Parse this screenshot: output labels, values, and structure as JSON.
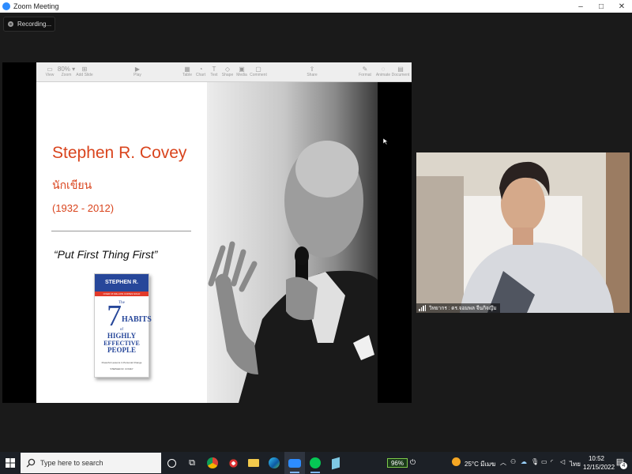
{
  "window": {
    "title": "Zoom Meeting",
    "controls": [
      "–",
      "□",
      "✕"
    ]
  },
  "recording": {
    "label": "Recording..."
  },
  "keynote_toolbar": {
    "items": [
      {
        "label": "View",
        "glyph": "▭"
      },
      {
        "label": "Zoom",
        "glyph": "80% ▾"
      },
      {
        "label": "Add Slide",
        "glyph": "⊞"
      },
      {
        "label": "Play",
        "glyph": "▶"
      },
      {
        "label": "Table",
        "glyph": "▦"
      },
      {
        "label": "Chart",
        "glyph": "◔"
      },
      {
        "label": "Text",
        "glyph": "T"
      },
      {
        "label": "Shape",
        "glyph": "◇"
      },
      {
        "label": "Media",
        "glyph": "▣"
      },
      {
        "label": "Comment",
        "glyph": "▢"
      },
      {
        "label": "Share",
        "glyph": "⇪"
      },
      {
        "label": "Format",
        "glyph": "✎"
      },
      {
        "label": "Animate",
        "glyph": "◌"
      },
      {
        "label": "Document",
        "glyph": "▤"
      }
    ]
  },
  "slide": {
    "name": "Stephen R. Covey",
    "role_thai": "นักเขียน",
    "years": "(1932 - 2012)",
    "quote": "“Put First Thing First”",
    "book": {
      "author": "STEPHEN R. COVEY",
      "strip": "OVER 15 MILLION COPIES SOLD",
      "the": "The",
      "seven": "7",
      "habits": "HABITS",
      "of": "of",
      "highly": "HIGHLY",
      "effective": "EFFECTIVE",
      "people": "PEOPLE",
      "subtitle": "Powerful Lessons in Personal Change",
      "author_small": "STEPHEN R. COVEY"
    }
  },
  "participant": {
    "name": "วิทยากร : ดร.จอมพล จีนกิจญึม"
  },
  "taskbar": {
    "search_placeholder": "Type here to search",
    "battery": "96%",
    "weather": "25°C มีเมฆ",
    "language": "ไทย",
    "time": "10:52",
    "date": "12/15/2022",
    "notifications": "4"
  },
  "colors": {
    "accent": "#d9441d",
    "zoom_blue": "#2D8CFF",
    "book_blue": "#27479a"
  }
}
